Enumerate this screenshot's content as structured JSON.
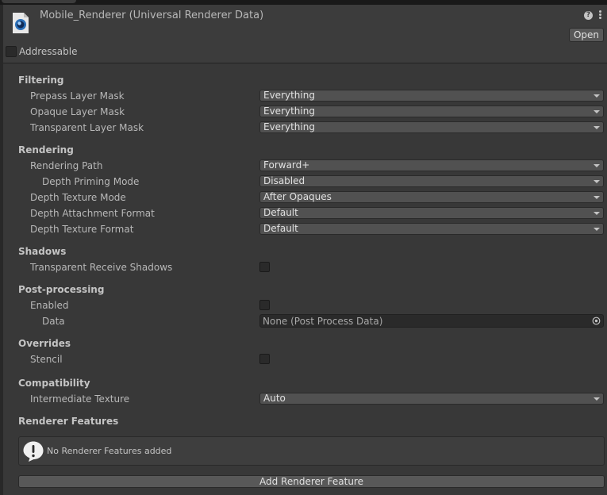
{
  "header": {
    "title": "Mobile_Renderer (Universal Renderer Data)",
    "help_icon": "help-icon",
    "menu_icon": "kebab-menu-icon",
    "open_label": "Open",
    "addressable_label": "Addressable",
    "addressable_checked": false
  },
  "filtering": {
    "title": "Filtering",
    "prepass_label": "Prepass Layer Mask",
    "prepass_value": "Everything",
    "opaque_label": "Opaque Layer Mask",
    "opaque_value": "Everything",
    "transparent_label": "Transparent Layer Mask",
    "transparent_value": "Everything"
  },
  "rendering": {
    "title": "Rendering",
    "path_label": "Rendering Path",
    "path_value": "Forward+",
    "priming_label": "Depth Priming Mode",
    "priming_value": "Disabled",
    "depth_tex_mode_label": "Depth Texture Mode",
    "depth_tex_mode_value": "After Opaques",
    "depth_attach_label": "Depth Attachment Format",
    "depth_attach_value": "Default",
    "depth_tex_format_label": "Depth Texture Format",
    "depth_tex_format_value": "Default"
  },
  "shadows": {
    "title": "Shadows",
    "receive_label": "Transparent Receive Shadows",
    "receive_checked": false
  },
  "post_processing": {
    "title": "Post-processing",
    "enabled_label": "Enabled",
    "enabled_checked": false,
    "data_label": "Data",
    "data_value": "None (Post Process Data)"
  },
  "overrides": {
    "title": "Overrides",
    "stencil_label": "Stencil",
    "stencil_checked": false
  },
  "compatibility": {
    "title": "Compatibility",
    "intermediate_label": "Intermediate Texture",
    "intermediate_value": "Auto"
  },
  "renderer_features": {
    "title": "Renderer Features",
    "empty_message": "No Renderer Features added",
    "add_label": "Add Renderer Feature"
  },
  "colors": {
    "background": "#383838",
    "header": "#3c3c3c",
    "dropdown": "#515151",
    "field_dark": "#2a2a2a",
    "button": "#585858",
    "text": "#c4c4c4"
  }
}
